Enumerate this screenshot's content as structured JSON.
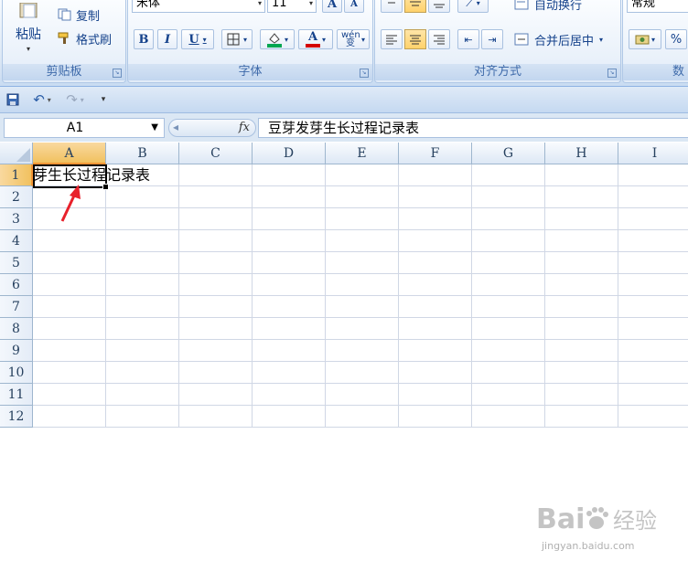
{
  "ribbon": {
    "clipboard": {
      "label": "剪贴板",
      "paste": "粘贴",
      "copy": "复制",
      "format_painter": "格式刷"
    },
    "font": {
      "label": "字体",
      "font_name": "宋体",
      "font_size": "11",
      "grow": "A",
      "shrink": "A",
      "bold": "B",
      "italic": "I",
      "underline": "U",
      "font_color_letter": "A",
      "phonetic": "wén 变"
    },
    "alignment": {
      "label": "对齐方式",
      "wrap_text": "自动换行",
      "merge_center": "合并后居中"
    },
    "number": {
      "label": "数",
      "format": "常规",
      "percent": "%",
      "comma": ","
    }
  },
  "formula_bar": {
    "name_box": "A1",
    "fx": "fx",
    "content": "豆芽发芽生长过程记录表"
  },
  "sheet": {
    "columns": [
      "A",
      "B",
      "C",
      "D",
      "E",
      "F",
      "G",
      "H",
      "I"
    ],
    "rows": [
      "1",
      "2",
      "3",
      "4",
      "5",
      "6",
      "7",
      "8",
      "9",
      "10",
      "11",
      "12"
    ],
    "visible_cell_text": "芽生长过程记录表",
    "active_cell": "A1"
  },
  "watermark": {
    "logo": "Bai 经验",
    "url": "jingyan.baidu.com"
  },
  "colors": {
    "ribbon_bg": "#dbe7f5",
    "selected_header": "#f1c15f",
    "arrow": "#e8212b",
    "green_fill": "#00a651",
    "red_font": "#d40000"
  }
}
